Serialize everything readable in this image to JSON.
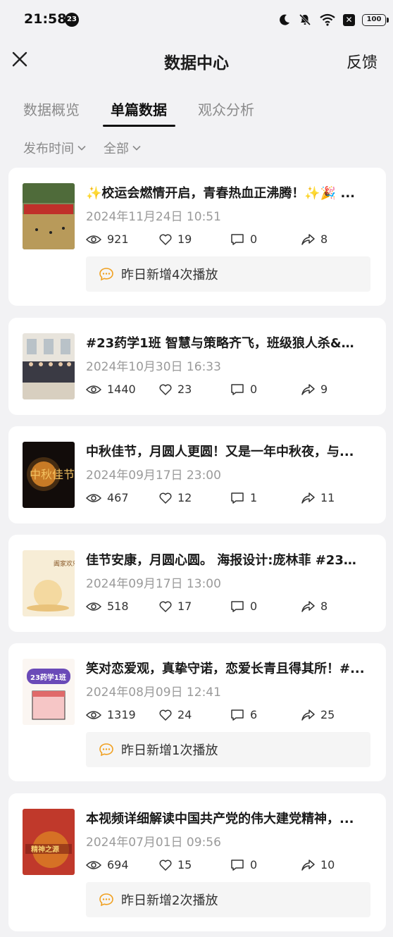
{
  "status_bar": {
    "time": "21:58",
    "notification_badge": "23",
    "battery": "100"
  },
  "header": {
    "title": "数据中心",
    "feedback_label": "反馈"
  },
  "tabs": [
    {
      "label": "数据概览",
      "active": false
    },
    {
      "label": "单篇数据",
      "active": true
    },
    {
      "label": "观众分析",
      "active": false
    }
  ],
  "filters": {
    "time_label": "发布时间",
    "scope_label": "全部"
  },
  "posts": [
    {
      "title": "✨校运会燃情开启，青春热血正沸腾！✨🎉 ...",
      "date": "2024年11月24日 10:51",
      "views": "921",
      "likes": "19",
      "comments": "0",
      "shares": "8",
      "notice": "昨日新增4次播放",
      "thumb_icon": "sports-field-photo"
    },
    {
      "title": "#23药学1班 智慧与策略齐飞，班级狼人杀&线...",
      "date": "2024年10月30日 16:33",
      "views": "1440",
      "likes": "23",
      "comments": "0",
      "shares": "9",
      "notice": "",
      "thumb_icon": "class-group-photo"
    },
    {
      "title": "中秋佳节，月圆人更圆！又是一年中秋夜，与...",
      "date": "2024年09月17日 23:00",
      "views": "467",
      "likes": "12",
      "comments": "1",
      "shares": "11",
      "notice": "",
      "thumb_icon": "mid-autumn-night-poster",
      "thumb_text": "中秋佳节"
    },
    {
      "title": "佳节安康，月圆心圆。 海报设计:庞林菲 #23药...",
      "date": "2024年09月17日 13:00",
      "views": "518",
      "likes": "17",
      "comments": "0",
      "shares": "8",
      "notice": "",
      "thumb_icon": "mid-autumn-light-poster",
      "thumb_text": "阖家欢乐"
    },
    {
      "title": "笑对恋爱观，真挚守诺，恋爱长青且得其所！#...",
      "date": "2024年08月09日 12:41",
      "views": "1319",
      "likes": "24",
      "comments": "6",
      "shares": "25",
      "notice": "昨日新增1次播放",
      "thumb_icon": "calendar-poster",
      "thumb_text": "23药学1班"
    },
    {
      "title": "本视频详细解读中国共产党的伟大建党精神，...",
      "date": "2024年07月01日 09:56",
      "views": "694",
      "likes": "15",
      "comments": "0",
      "shares": "10",
      "notice": "昨日新增2次播放",
      "thumb_icon": "party-spirit-poster",
      "thumb_text": "精神之源"
    }
  ],
  "colors": {
    "accent": "#111111",
    "notice_icon": "#f0a020",
    "muted": "#9a9a9a"
  }
}
